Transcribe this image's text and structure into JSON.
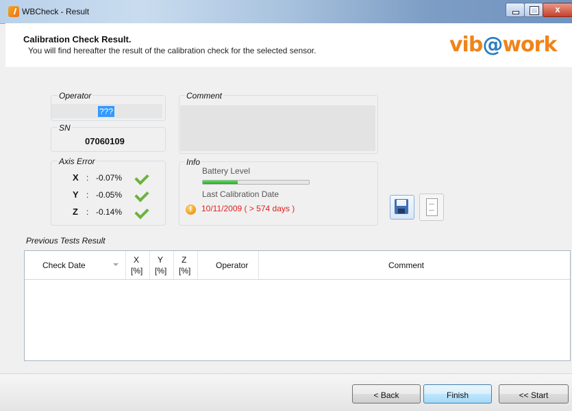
{
  "window": {
    "title": "WBCheck - Result",
    "close_glyph": "x"
  },
  "header": {
    "title": "Calibration Check Result.",
    "subtitle": "You will find hereafter the result of the calibration check for the selected sensor.",
    "logo_prefix": "vib",
    "logo_at": "@",
    "logo_suffix": "work",
    "logo_color": "#f08419",
    "logo_at_color": "#2a7ec1"
  },
  "operator": {
    "label": "Operator",
    "value": "???"
  },
  "serial": {
    "label": "SN",
    "value": "07060109"
  },
  "comment": {
    "label": "Comment",
    "value": ""
  },
  "axis_error": {
    "label": "Axis Error",
    "rows": [
      {
        "axis": "X",
        "colon": ":",
        "value": "-0.07%",
        "status_icon": "checkmark-icon"
      },
      {
        "axis": "Y",
        "colon": ":",
        "value": "-0.05%",
        "status_icon": "checkmark-icon"
      },
      {
        "axis": "Z",
        "colon": ":",
        "value": "-0.14%",
        "status_icon": "checkmark-icon"
      }
    ],
    "ok_color": "#6cb33e"
  },
  "info": {
    "label": "Info",
    "battery_label": "Battery Level",
    "battery_level": 0.33,
    "last_calibration_label": "Last Calibration Date",
    "last_calibration_value": "10/11/2009 ( > 574 days )",
    "warning_glyph": "!",
    "warning_color": "#e02020"
  },
  "actions": {
    "save_icon": "save-icon",
    "report_icon": "document-icon"
  },
  "previous_tests": {
    "label": "Previous Tests Result",
    "columns": [
      {
        "label": "Check Date"
      },
      {
        "label": "X",
        "sub": "[%]"
      },
      {
        "label": "Y",
        "sub": "[%]"
      },
      {
        "label": "Z",
        "sub": "[%]"
      },
      {
        "label": "Operator"
      },
      {
        "label": "Comment"
      }
    ],
    "rows": []
  },
  "buttons": {
    "back": "< Back",
    "finish": "Finish",
    "start": "<< Start"
  }
}
